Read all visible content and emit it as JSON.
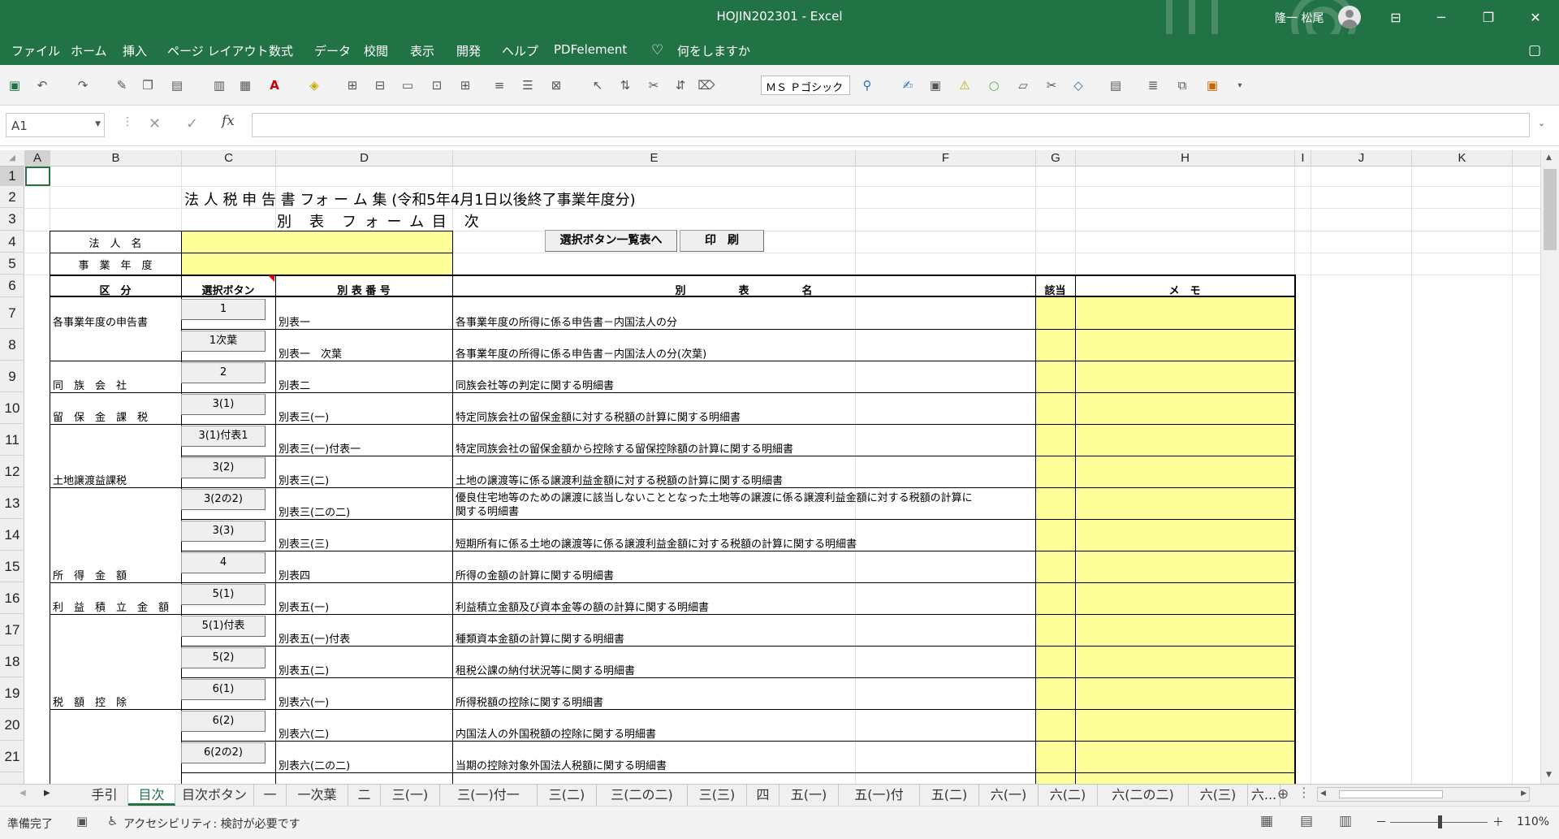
{
  "window": {
    "title": "HOJIN202301  -  Excel",
    "user": "隆一 松尾",
    "min_icon": "─",
    "max_icon": "❐",
    "close_icon": "✕",
    "ribbon_icon": "⊟"
  },
  "menu": [
    "ファイル",
    "ホーム",
    "挿入",
    "ページ レイアウト",
    "数式",
    "データ",
    "校閲",
    "表示",
    "開発",
    "ヘルプ",
    "PDFelement",
    "何をしますか"
  ],
  "toolbar": {
    "font_name": "ＭＳ Ｐゴシック"
  },
  "formula": {
    "name_box": "A1",
    "cancel": "✕",
    "enter": "✓",
    "fx": "fx",
    "value": ""
  },
  "columns": [
    "A",
    "B",
    "C",
    "D",
    "E",
    "F",
    "G",
    "H",
    "I",
    "J",
    "K"
  ],
  "rows": [
    "1",
    "2",
    "3",
    "4",
    "5",
    "6",
    "7",
    "8",
    "9",
    "10",
    "11",
    "12",
    "13",
    "14",
    "15",
    "16",
    "17",
    "18",
    "19",
    "20",
    "21"
  ],
  "sheet": {
    "title": "法 人 税 申 告 書 フォ ー ム 集 (令和5年4月1日以後終了事業年度分)",
    "subtitle": "別　表　フ ォ ー ム 目　次",
    "corp_name_label": "法　人　名",
    "fiscal_year_label": "事　業　年　度",
    "goto_list_button": "選択ボタン一覧表へ",
    "print_button": "印　刷",
    "headers": {
      "kubun": "区　分",
      "button": "選択ボタン",
      "number": "別 表 番 号",
      "name": "別　　　　　表　　　　　名",
      "applicable": "該当",
      "memo": "メ　モ"
    },
    "entries": [
      {
        "category": "各事業年度の申告書",
        "button": "1",
        "number": "別表一",
        "name": "各事業年度の所得に係る申告書－内国法人の分"
      },
      {
        "category": "",
        "button": "1次葉",
        "number": "別表一　次葉",
        "name": "各事業年度の所得に係る申告書－内国法人の分(次葉)"
      },
      {
        "category": "同　族　会　社",
        "button": "2",
        "number": "別表二",
        "name": "同族会社等の判定に関する明細書"
      },
      {
        "category": "留　保　金　課　税",
        "button": "3(1)",
        "number": "別表三(一)",
        "name": "特定同族会社の留保金額に対する税額の計算に関する明細書"
      },
      {
        "category": "",
        "button": "3(1)付表1",
        "number": "別表三(一)付表一",
        "name": "特定同族会社の留保金額から控除する留保控除額の計算に関する明細書"
      },
      {
        "category": "土地譲渡益課税",
        "button": "3(2)",
        "number": "別表三(二)",
        "name": "土地の譲渡等に係る譲渡利益金額に対する税額の計算に関する明細書"
      },
      {
        "category": "",
        "button": "3(2の2)",
        "number": "別表三(二の二)",
        "name": "優良住宅地等のための譲渡に該当しないこととなった土地等の譲渡に係る譲渡利益金額に対する税額の計算に",
        "name2": "関する明細書"
      },
      {
        "category": "",
        "button": "3(3)",
        "number": "別表三(三)",
        "name": "短期所有に係る土地の譲渡等に係る譲渡利益金額に対する税額の計算に関する明細書"
      },
      {
        "category": "所　得　金　額",
        "button": "4",
        "number": "別表四",
        "name": "所得の金額の計算に関する明細書"
      },
      {
        "category": "利　益　積　立　金　額",
        "button": "5(1)",
        "number": "別表五(一)",
        "name": "利益積立金額及び資本金等の額の計算に関する明細書"
      },
      {
        "category": "",
        "button": "5(1)付表",
        "number": "別表五(一)付表",
        "name": "種類資本金額の計算に関する明細書"
      },
      {
        "category": "",
        "button": "5(2)",
        "number": "別表五(二)",
        "name": "租税公課の納付状況等に関する明細書"
      },
      {
        "category": "税　額　控　除",
        "button": "6(1)",
        "number": "別表六(一)",
        "name": "所得税額の控除に関する明細書"
      },
      {
        "category": "",
        "button": "6(2)",
        "number": "別表六(二)",
        "name": "内国法人の外国税額の控除に関する明細書"
      },
      {
        "category": "",
        "button": "6(2の2)",
        "number": "別表六(二の二)",
        "name": "当期の控除対象外国法人税額に関する明細書"
      }
    ]
  },
  "tabs": [
    "手引",
    "目次",
    "目次ボタン",
    "一",
    "一次葉",
    "二",
    "三(一)",
    "三(一)付一",
    "三(二)",
    "三(二の二)",
    "三(三)",
    "四",
    "五(一)",
    "五(一)付",
    "五(二)",
    "六(一)",
    "六(二)",
    "六(二の二)",
    "六(三)",
    "六..."
  ],
  "status": {
    "ready": "準備完了",
    "accessibility": "アクセシビリティ: 検討が必要です",
    "zoom": "110%",
    "zoom_minus": "－",
    "zoom_plus": "＋"
  }
}
